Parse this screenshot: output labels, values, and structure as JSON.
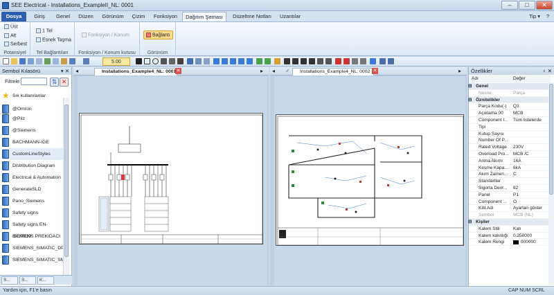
{
  "window": {
    "title": "SEE Electrical - Installations_ExampleII_NL: 0001",
    "min": "–",
    "max": "□",
    "close": "✕"
  },
  "menu": {
    "tabs": [
      "Dosya",
      "Giriş",
      "Genel",
      "Düzen",
      "Görünüm",
      "Çizim",
      "Fonksiyon",
      "Dağıtım Şeması",
      "Düzeltme Notları",
      "Uzantılar"
    ],
    "tip": "Tip ▾",
    "help": "?"
  },
  "ribbon": {
    "potansiyel": {
      "label": "Potansiyel",
      "items": [
        "Üst",
        "Alt",
        "Serbest"
      ]
    },
    "tel": {
      "label": "Tel Bağlantıları",
      "items": [
        "1 Tel",
        "Esnek Taşma"
      ]
    },
    "fonk": {
      "label": "Fonksiyon / Konum kutusu",
      "item": "Fonksiyon / Konum"
    },
    "gorunum": {
      "label": "Görünüm",
      "item": "Bağlantı"
    }
  },
  "toolbar": {
    "zoom": "5.00"
  },
  "left": {
    "title": "Sembol Kılasörü",
    "pin": "▾ ✕",
    "filter_label": "Filtrele:",
    "filter_value": "",
    "items": [
      "Sık kullanılanlar",
      "@Omron",
      "@Pilz",
      "@Siemens",
      "BACHMANN-IGE",
      "CustomLineStyles",
      "Distribution Diagram",
      "Electrical & Automation",
      "GenerateSLD",
      "Pano_Siemens",
      "Safety signs",
      "Safety signs EN-ISO7010",
      "SIEMENS PREKIDACI",
      "SIEMENS_SIMATIC_DP",
      "SIEMENS_SIMATIC_SM"
    ],
    "tabs": [
      "S...",
      "S...",
      "K..."
    ]
  },
  "doc1": {
    "tab": "Installations_Example4_NL: 0001"
  },
  "doc2": {
    "tab": "Installations_Example4_NL: 0002"
  },
  "props": {
    "title": "Özellikler",
    "pin": "♀ ✕",
    "col_name": "Adı",
    "col_value": "Değer",
    "rows": [
      {
        "s": 1,
        "k": "Genel",
        "v": ""
      },
      {
        "k": "Nesne",
        "v": "Parça",
        "d": 1
      },
      {
        "s": 1,
        "k": "Öznitelikler",
        "v": ""
      },
      {
        "k": "Parça Kodu(-)",
        "v": "Q3"
      },
      {
        "k": "Açıklama 00",
        "v": "MCB"
      },
      {
        "k": "Component I...",
        "v": "Tüm listelerde"
      },
      {
        "k": "Tipi",
        "v": ""
      },
      {
        "k": "Kutup Sayısı",
        "v": ""
      },
      {
        "k": "Number Of P...",
        "v": ""
      },
      {
        "k": "Rated Voltage",
        "v": "230V"
      },
      {
        "k": "Overload Pro...",
        "v": "MCB /C"
      },
      {
        "k": "Anma Akımı",
        "v": "16A"
      },
      {
        "k": "Kesme Kapa...",
        "v": "6kA"
      },
      {
        "k": "Akım Zamen...",
        "v": "C"
      },
      {
        "k": "Standartlar",
        "v": ""
      },
      {
        "k": "Sigorta Devr...",
        "v": "82"
      },
      {
        "k": "Panel",
        "v": "P1"
      },
      {
        "k": "Component ...",
        "v": "O"
      },
      {
        "k": "Kilit Adı",
        "v": "Ayarları göster"
      },
      {
        "k": "Sembol",
        "v": "MCB (NL)",
        "d": 1
      },
      {
        "s": 1,
        "k": "Kişiler",
        "v": ""
      },
      {
        "k": "Kalem Stili",
        "v": "Katı"
      },
      {
        "k": "Kalem kalınlığı",
        "v": "0.250000"
      },
      {
        "k": "Kalem Rengi",
        "v": "000000"
      }
    ]
  },
  "status": {
    "left": "Yardım için, F1'e basın",
    "right": "CAP  NUM  SCRL"
  }
}
